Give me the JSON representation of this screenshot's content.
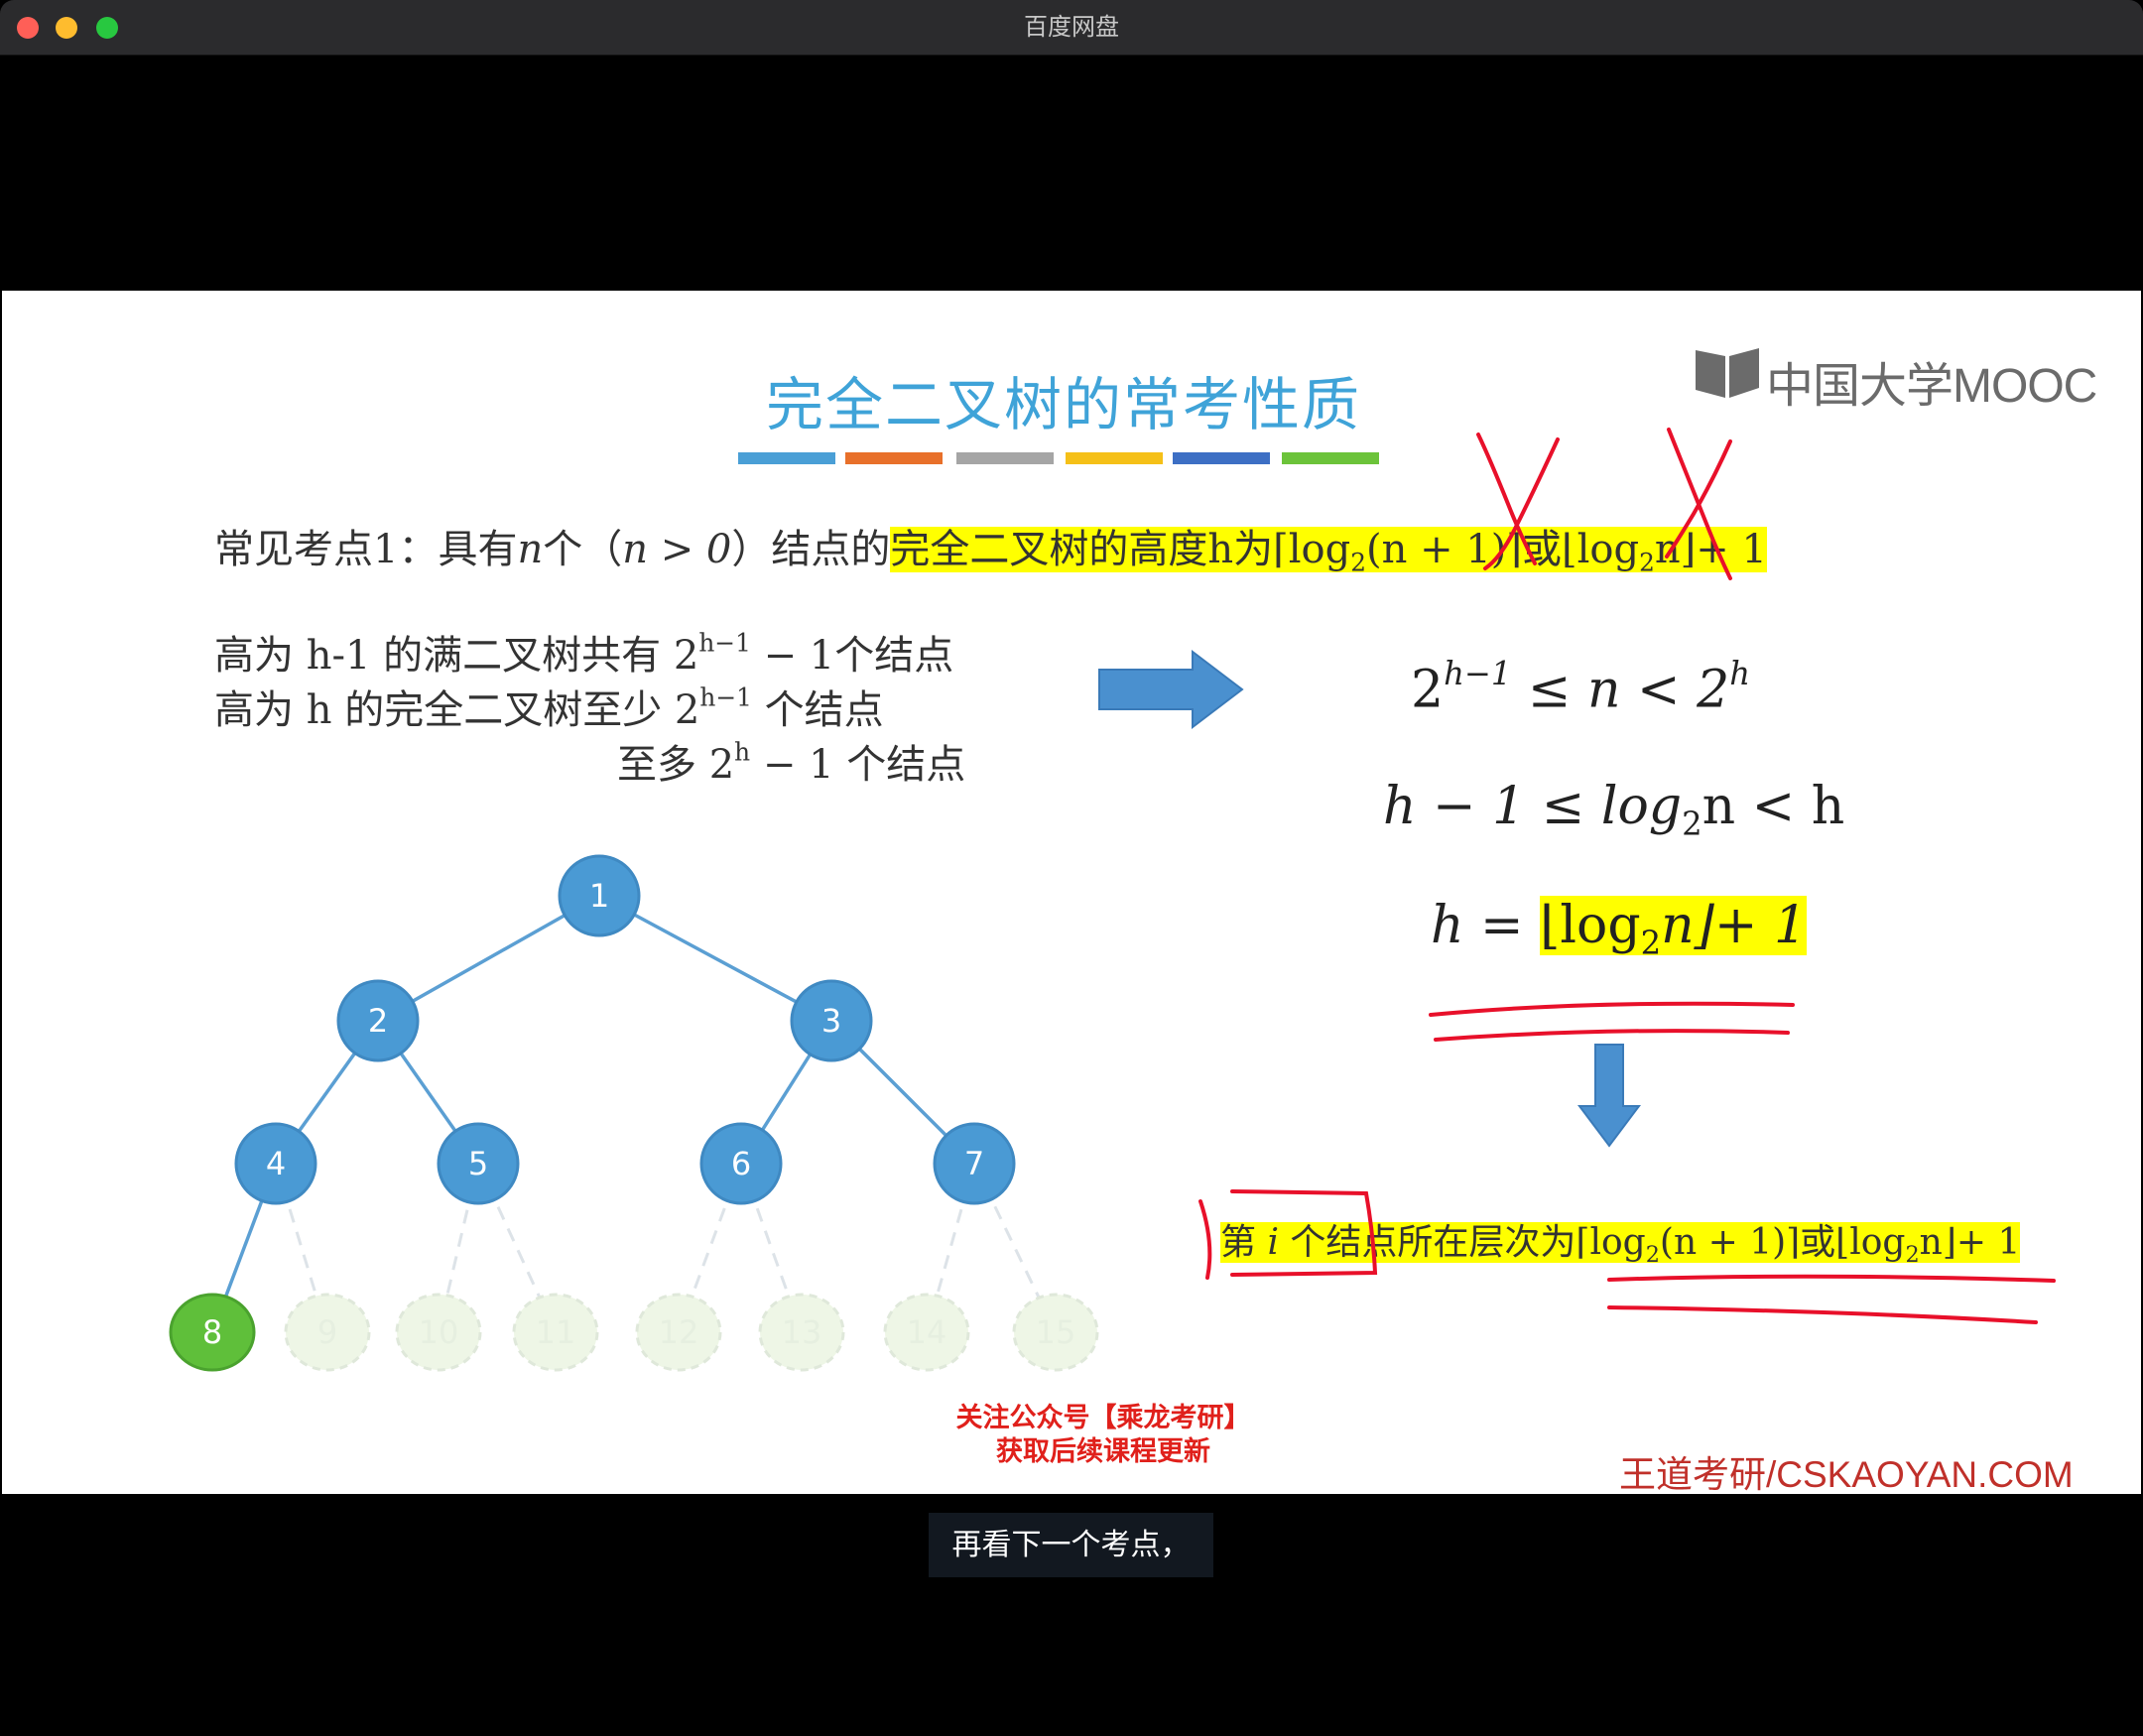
{
  "window": {
    "title": "百度网盘"
  },
  "slide": {
    "title": "完全二叉树的常考性质",
    "title_bar_colors": [
      "#4a9fd6",
      "#e8702a",
      "#a5a5a5",
      "#f5c018",
      "#3d6fc4",
      "#6cc33a"
    ],
    "logo_text": "中国大学MOOC",
    "point1_prefix": "常见考点1：具有",
    "point1_n": "n",
    "point1_mid": "个（",
    "point1_cond": "n > 0",
    "point1_suffix": "）结点的",
    "point1_highlight": "完全二叉树的高度h为⌈log",
    "point1_hl_sub": "2",
    "point1_hl_rest": "(n + 1)⌉或⌊log",
    "point1_hl_sub2": "2",
    "point1_hl_end": "n⌋+ 1",
    "line_a_pre": "高为 h-1 的满二叉树共有 2",
    "line_a_sup": "h−1",
    "line_a_post": " − 1个结点",
    "line_b_pre": "高为 h 的完全二叉树至少 2",
    "line_b_sup": "h−1",
    "line_b_post": " 个结点",
    "line_c_pre": "至多 2",
    "line_c_sup": "h",
    "line_c_post": " − 1 个结点",
    "ineq1_a": "2",
    "ineq1_sup1": "h−1",
    "ineq1_b": " ≤ n < 2",
    "ineq1_sup2": "h",
    "ineq2_a": "h − 1 ≤ log",
    "ineq2_sub": "2",
    "ineq2_b": "n < h",
    "eq_a": "h = ",
    "eq_hl_a": "⌊log",
    "eq_hl_sub": "2",
    "eq_hl_b": "n⌋+ 1",
    "level_pre": "第 ",
    "level_i": "i",
    "level_mid": " 个结点所在层次为⌈log",
    "level_sub": "2",
    "level_mid2": "(n + 1)⌉或⌊log",
    "level_sub2": "2",
    "level_end": "n⌋+ 1",
    "promo_line1": "关注公众号【乘龙考研】",
    "promo_line2": "获取后续课程更新",
    "brand": "王道考研/CSKAOYAN.COM",
    "tree_nodes": [
      "1",
      "2",
      "3",
      "4",
      "5",
      "6",
      "7",
      "8",
      "9",
      "10",
      "11",
      "12",
      "13",
      "14",
      "15"
    ]
  },
  "caption": {
    "text": "再看下一个考点，"
  },
  "colors": {
    "node_blue": "#4a9ad4",
    "node_green": "#5fbf3a",
    "highlight": "#ffff00",
    "pen_red": "#e8102a",
    "arrow_blue": "#4a90cf"
  }
}
